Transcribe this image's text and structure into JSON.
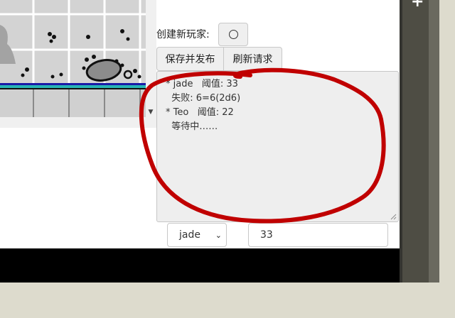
{
  "new_player": {
    "label": "创建新玩家:",
    "button_icon": "circle-icon"
  },
  "toolbar": {
    "save_publish_label": "保存并发布",
    "refresh_label": "刷新请求"
  },
  "log": {
    "lines": [
      "* jade   阈值: 33",
      "  失败: 6=6(2d6)",
      "* Teo   阈值: 22",
      "  等待中……"
    ]
  },
  "controls": {
    "selected_player": "jade",
    "threshold_value": "33"
  },
  "annotation": {
    "color": "#c00000",
    "shape": "freehand-circle"
  }
}
